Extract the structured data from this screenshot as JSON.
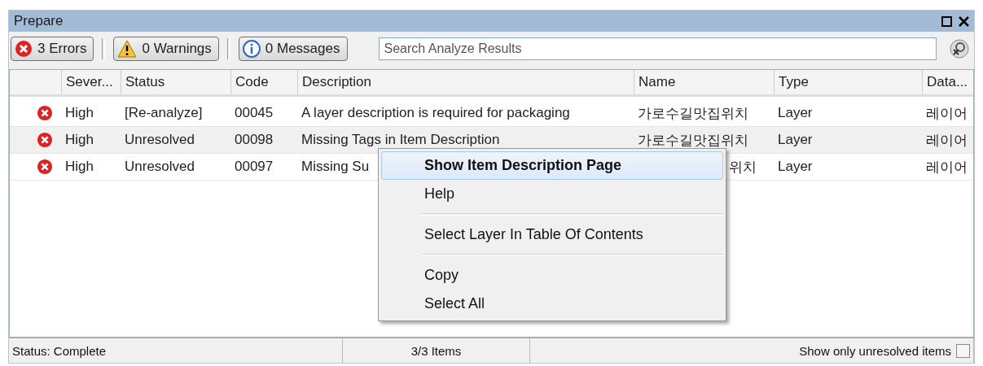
{
  "panel": {
    "title": "Prepare"
  },
  "filters": [
    {
      "kind": "error",
      "label": "3 Errors"
    },
    {
      "kind": "warning",
      "label": "0 Warnings"
    },
    {
      "kind": "info",
      "label": "0 Messages"
    }
  ],
  "search": {
    "placeholder": "Search Analyze Results"
  },
  "table": {
    "columns": [
      "Sever...",
      "Status",
      "Code",
      "Description",
      "Name",
      "Type",
      "Data..."
    ],
    "rows": [
      {
        "cells": [
          "High",
          "[Re-analyze]",
          "00045",
          "A layer description is required for packaging",
          "가로수길맛집위치",
          "Layer",
          "레이어"
        ],
        "covered": false
      },
      {
        "cells": [
          "High",
          "Unresolved",
          "00098",
          "Missing Tags in Item Description",
          "가로수길맛집위치",
          "Layer",
          "레이어"
        ],
        "covered": false
      },
      {
        "cells": [
          "High",
          "Unresolved",
          "00097",
          "Missing Su",
          "위치",
          "Layer",
          "레이어"
        ],
        "covered": true
      }
    ]
  },
  "context_menu": {
    "items": [
      {
        "kind": "item",
        "label": "Show Item Description Page",
        "selected": true
      },
      {
        "kind": "item",
        "label": "Help",
        "selected": false
      },
      {
        "kind": "separator"
      },
      {
        "kind": "item",
        "label": "Select Layer In Table Of Contents",
        "selected": false
      },
      {
        "kind": "separator"
      },
      {
        "kind": "item",
        "label": "Copy",
        "selected": false
      },
      {
        "kind": "item",
        "label": "Select All",
        "selected": false
      }
    ]
  },
  "status_bar": {
    "status": "Status: Complete",
    "count": "3/3 Items",
    "filter_label": "Show only unresolved items",
    "filter_checked": false
  }
}
